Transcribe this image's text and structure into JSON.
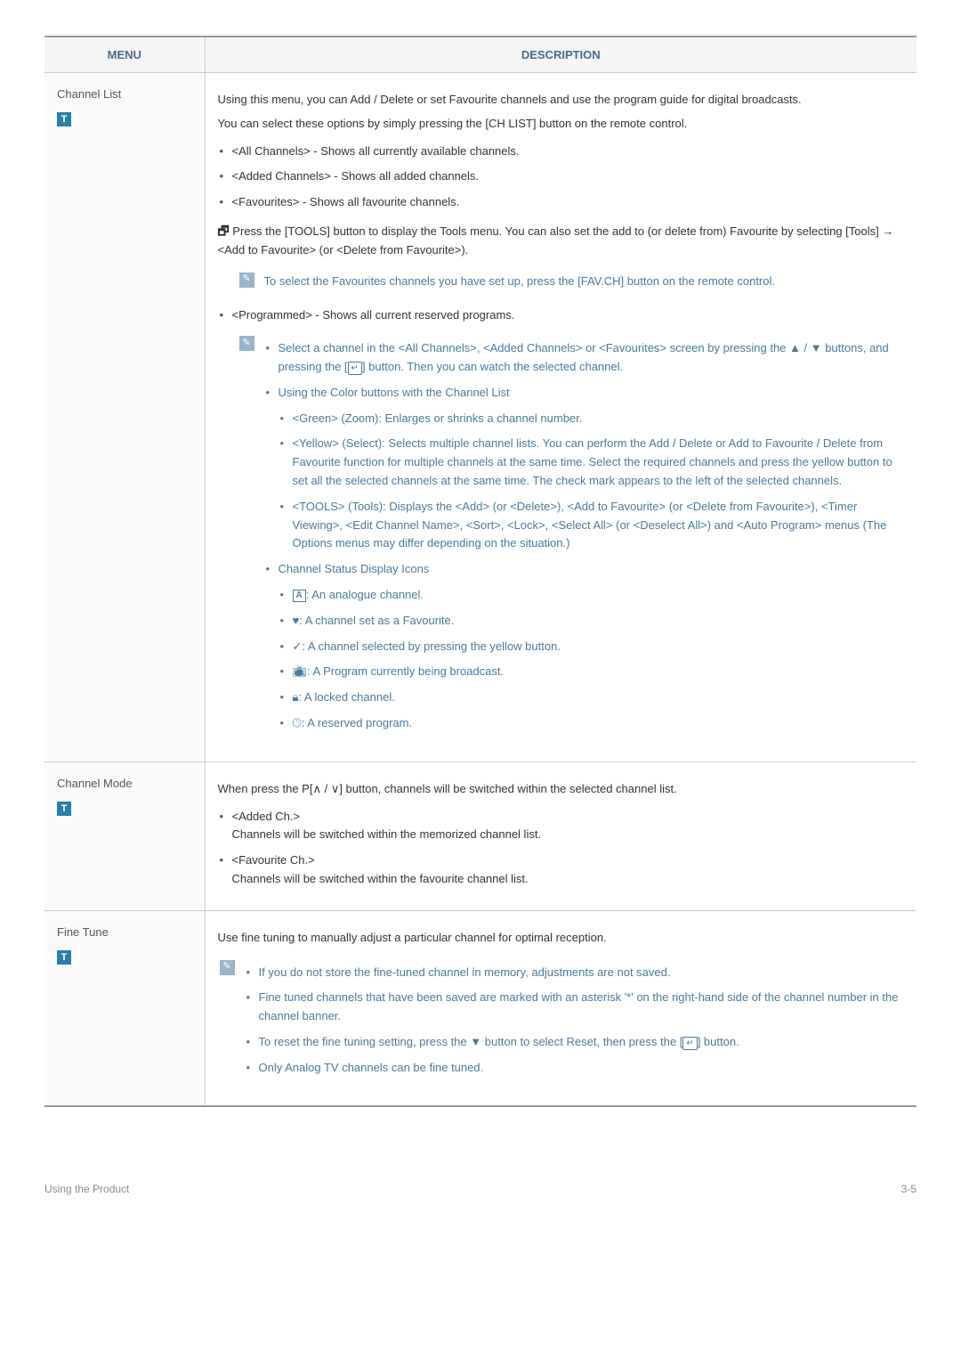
{
  "header": {
    "menu": "MENU",
    "desc": "DESCRIPTION"
  },
  "row1": {
    "title": "Channel List",
    "p1": "Using this menu, you can Add / Delete or set Favourite channels and use the program guide for digital broadcasts.",
    "p2": "You can select these options by simply pressing the [CH LIST] button on the remote control.",
    "b1": "<All Channels> - Shows all currently available channels.",
    "b2": "<Added Channels> - Shows all added channels.",
    "b3": "<Favourites> - Shows all favourite channels.",
    "tools_pre": "",
    "tools": " Press the [TOOLS] button to display the Tools menu. You can also set the add to (or delete from) Favourite by selecting [Tools] → <Add to Favourite> (or <Delete from Favourite>).",
    "note1": "To select the Favourites channels you have set up, press the [FAV.CH] button on the remote control.",
    "b4": "<Programmed> - Shows all current reserved programs.",
    "n2a": "Select a channel in the <All Channels>, <Added Channels> or <Favourites> screen by pressing the ▲ / ▼ buttons, and pressing the [",
    "n2b": "] button. Then you can watch the selected channel.",
    "u1": "Using the Color buttons with the Channel List",
    "u1a": "<Green> (Zoom): Enlarges or shrinks a channel number.",
    "u1b": "<Yellow> (Select): Selects multiple channel lists. You can perform the Add / Delete or Add to Favourite / Delete from Favourite function for multiple channels at the same time. Select the required channels and press the yellow button to set all the selected channels at the same time. The check mark appears to the left of the selected channels.",
    "u1c": "<TOOLS> (Tools): Displays the <Add> (or <Delete>), <Add to Favourite> (or <Delete from Favourite>), <Timer Viewing>, <Edit Channel Name>, <Sort>, <Lock>, <Select All> (or <Deselect All>) and <Auto Program> menus (The Options menus may differ depending on the situation.)",
    "u2": "Channel Status Display Icons",
    "i1a": "A",
    "i1b": ": An analogue channel.",
    "i2b": ": A channel set as a Favourite.",
    "i3b": ": A channel selected by pressing the yellow button.",
    "i4b": ": A Program currently being broadcast.",
    "i5b": ": A locked channel.",
    "i6b": ": A reserved program."
  },
  "row2": {
    "title": "Channel Mode",
    "p1a": "When press the P[",
    "p1b": " / ",
    "p1c": "] button, channels will be switched within the selected channel list.",
    "b1": "<Added Ch.>",
    "b1s": "Channels will be switched within the memorized channel list.",
    "b2": "<Favourite Ch.>",
    "b2s": "Channels will be switched within the favourite channel list."
  },
  "row3": {
    "title": "Fine Tune",
    "p1": "Use fine tuning to manually adjust a particular channel for optimal reception.",
    "n1": "If you do not store the fine-tuned channel in memory, adjustments are not saved.",
    "n2": "Fine tuned channels that have been saved are marked with an asterisk '*' on the right-hand side of the channel number in the channel banner.",
    "n3a": "To reset the fine tuning setting, press the ▼ button to select Reset, then press the [",
    "n3b": "] button.",
    "n4": "Only Analog TV channels can be fine tuned."
  },
  "footer": {
    "left": "Using the Product",
    "right": "3-5"
  }
}
